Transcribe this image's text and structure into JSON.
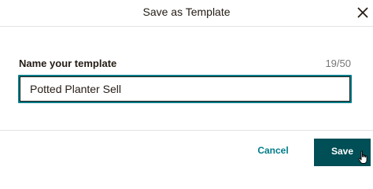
{
  "dialog": {
    "title": "Save as Template",
    "close_icon": "close-icon"
  },
  "form": {
    "label": "Name your template",
    "counter": "19/50",
    "input_value": "Potted Planter Sell"
  },
  "footer": {
    "cancel_label": "Cancel",
    "save_label": "Save"
  },
  "colors": {
    "accent": "#007c89",
    "primary_button": "#004e56",
    "text": "#241c15"
  },
  "icons": {
    "pointer": "hand-pointer-icon"
  }
}
